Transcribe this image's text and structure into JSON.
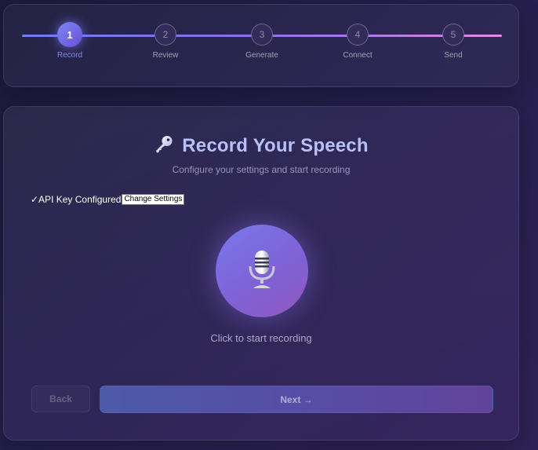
{
  "stepper": {
    "steps": [
      {
        "number": "1",
        "label": "Record",
        "active": true
      },
      {
        "number": "2",
        "label": "Review",
        "active": false
      },
      {
        "number": "3",
        "label": "Generate",
        "active": false
      },
      {
        "number": "4",
        "label": "Connect",
        "active": false
      },
      {
        "number": "5",
        "label": "Send",
        "active": false
      }
    ]
  },
  "card": {
    "title_icon": "key-icon",
    "title": "Record Your Speech",
    "subtitle": "Configure your settings and start recording",
    "api_status": "✓API Key Configured",
    "change_settings_label": "Change Settings",
    "record_icon": "microphone-icon",
    "record_caption": "Click to start recording",
    "back_label": "Back",
    "next_label": "Next →"
  },
  "colors": {
    "accent": "#7c86f6",
    "title": "#b9c0f9",
    "background": "#241f4c"
  }
}
